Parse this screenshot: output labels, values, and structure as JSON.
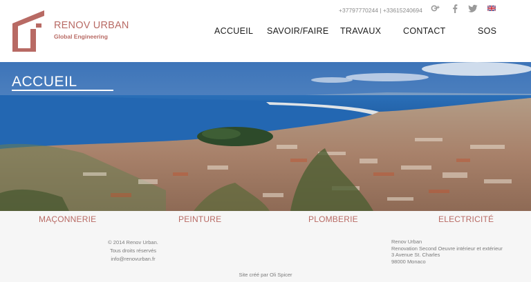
{
  "logo": {
    "name": "RENOV URBAN",
    "tagline": "Global Engineering",
    "icon": "house-u-logo"
  },
  "contact": {
    "phones": "+37797770244 | +33615240694"
  },
  "social": [
    {
      "icon": "google-plus-icon",
      "label": "g+"
    },
    {
      "icon": "facebook-icon",
      "label": "f"
    },
    {
      "icon": "twitter-icon",
      "label": "twitter"
    },
    {
      "icon": "uk-flag-icon",
      "label": "English"
    }
  ],
  "nav": {
    "items": [
      "ACCUEIL",
      "SAVOIR/FAIRE",
      "TRAVAUX",
      "CONTACT",
      "SOS"
    ]
  },
  "hero": {
    "title": "ACCUEIL"
  },
  "services": [
    "MAÇONNERIE",
    "PEINTURE",
    "PLOMBERIE",
    "ELECTRICITÉ"
  ],
  "footer": {
    "left": [
      "© 2014 Renov Urban.",
      "Tous droits réservés",
      "info@renovurban.fr"
    ],
    "right": [
      "Renov Urban",
      "Renovation Second Oeuvre intérieur et extérieur",
      "3 Avenue St. Charles",
      "98000 Monaco"
    ],
    "credit": "Site créé par Oli Spicer"
  },
  "colors": {
    "brand": "#b86a64",
    "nav_text": "#1b1b1b",
    "footer_bg": "#f6f6f6",
    "sea": "#1f5fa8"
  }
}
